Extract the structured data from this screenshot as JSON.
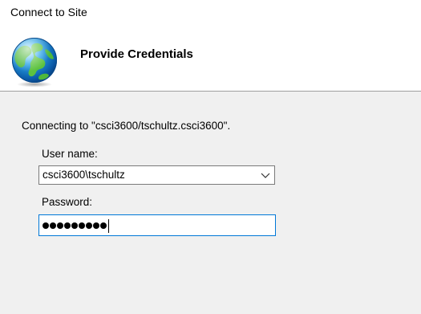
{
  "window": {
    "title": "Connect to Site"
  },
  "header": {
    "title": "Provide Credentials",
    "icon": "globe-icon"
  },
  "body": {
    "connecting_text": "Connecting to \"csci3600/tschultz.csci3600\".",
    "username": {
      "label": "User name:",
      "value": "csci3600\\tschultz"
    },
    "password": {
      "label": "Password:",
      "masked_length": 9
    }
  },
  "colors": {
    "focus_border": "#0078d7",
    "panel_bg": "#f0f0f0",
    "header_bg": "#ffffff"
  }
}
